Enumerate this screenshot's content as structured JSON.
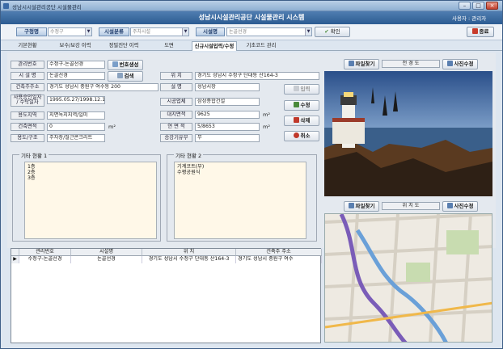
{
  "window": {
    "title": "성남시시설관리공단 시설물관리"
  },
  "header": {
    "system_title": "성남시시설관리공단 시설물관리 시스템",
    "user": "사용자 : 관리자"
  },
  "filter": {
    "region_label": "구청명",
    "region_value": "수정구",
    "type_label": "시설분류",
    "type_value": "주차시설",
    "facility_label": "시설명",
    "facility_value": "논골선경",
    "confirm_label": "확인",
    "exit_label": "종료"
  },
  "tabs": [
    {
      "label": "기본현황"
    },
    {
      "label": "보수/보강 이력"
    },
    {
      "label": "정밀진단 이력"
    },
    {
      "label": "도면"
    },
    {
      "label": "신규시설입력/수정"
    },
    {
      "label": "기초코드 관리"
    }
  ],
  "form": {
    "mgmt_no_label": "관리번호",
    "mgmt_no": "수정구-논골선경",
    "number_gen_label": "번호생성",
    "facility_name_label": "시 설 명",
    "facility_name": "논골선경",
    "search_label": "검색",
    "owner_addr_label": "건축주주소",
    "owner_addr": "경기도 성남시 중원구 여수동 200",
    "approval_label": "사용승인일자\n/ 수탁일자",
    "approval": "1995.05.27/1998.12.19",
    "zoning_label": "용도지역",
    "zoning": "지면녹지지역/일미",
    "building_area_label": "건축면적",
    "building_area": "0",
    "use_struct_label": "용도/구조",
    "use_struct": "주차장/철근콘크리트",
    "location_label": "위 치",
    "location": "경기도 성남시 수정구 단대동 산164-3",
    "designer_label": "설 명",
    "designer": "성남시장",
    "contractor_label": "시공업체",
    "contractor": "삼성종합건설",
    "site_area_label": "대지면적",
    "site_area": "9625",
    "floor_area_label": "연 면 적",
    "floor_area": "5/8653",
    "elevator_label": "승강기유무",
    "elevator": "무",
    "unit_m2": "m²",
    "other_status1_label": "기타 현황 1",
    "other_status1": "1층\n2층\n3층",
    "other_status2_label": "기타 현황 2",
    "other_status2": "기계코트(부)\n수평공원식"
  },
  "actions": {
    "input": "입력",
    "edit": "수정",
    "delete": "삭제",
    "cancel": "취소"
  },
  "photo_panel": {
    "find_file": "파일찾기",
    "title": "전 경 도",
    "photo_edit": "사진수정"
  },
  "map_panel": {
    "find_file": "파일찾기",
    "title": "위 치 도",
    "photo_edit": "사진수정"
  },
  "table": {
    "columns": [
      "관리번호",
      "시설명",
      "위 치",
      "건축주 주소"
    ],
    "rows": [
      [
        "수정구-논골선경",
        "논골선경",
        "경기도 성남시 수정구 단대동 산164-3",
        "경기도 성남시 중원구 여수"
      ]
    ]
  },
  "colors": {
    "header_blue": "#2d5c92",
    "accent_red": "#c0392b"
  }
}
